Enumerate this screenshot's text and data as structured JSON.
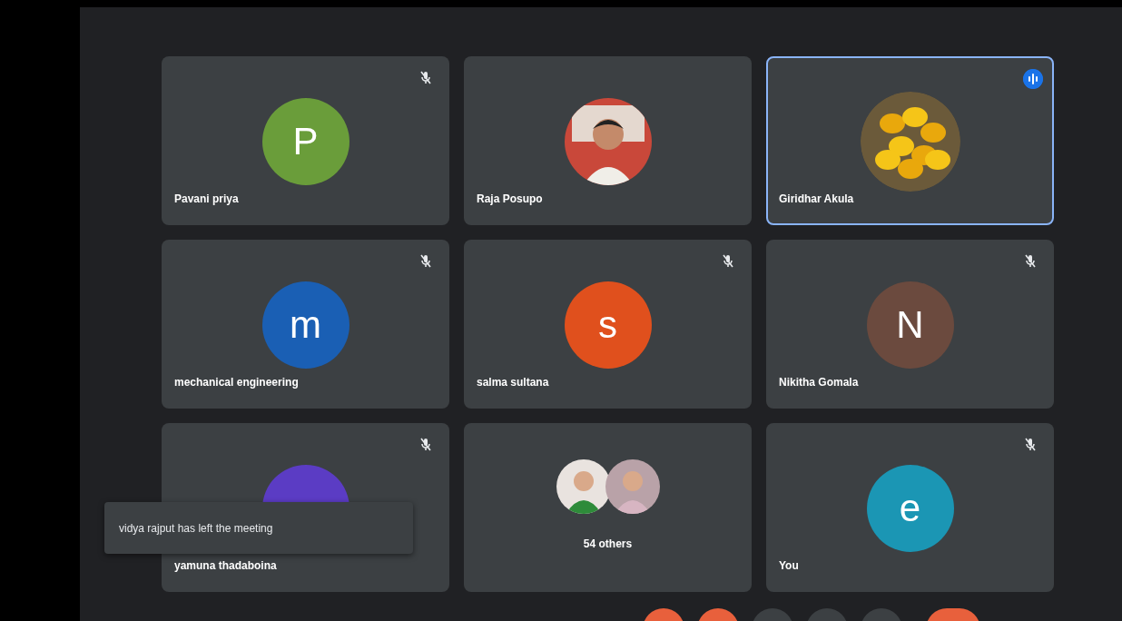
{
  "tiles": [
    {
      "kind": "letter",
      "letter": "P",
      "color": "#6a9d3a",
      "name": "Pavani priya",
      "muted": true,
      "speaking": false
    },
    {
      "name": "Raja Posupo",
      "muted": false,
      "speaking": false
    },
    {
      "name": "Giridhar Akula",
      "muted": false,
      "speaking": true
    },
    {
      "kind": "letter",
      "letter": "m",
      "color": "#1a5fb4",
      "name": "mechanical engineering",
      "muted": true,
      "speaking": false
    },
    {
      "kind": "letter",
      "letter": "s",
      "color": "#e0501d",
      "name": "salma sultana",
      "muted": true,
      "speaking": false
    },
    {
      "kind": "letter",
      "letter": "N",
      "color": "#6b4a3e",
      "name": "Nikitha Gomala",
      "muted": true,
      "speaking": false
    },
    {
      "kind": "letter",
      "color": "#5b3cc4",
      "name": "yamuna thadaboina",
      "muted": true,
      "speaking": false
    },
    {
      "kind": "others",
      "name": "54 others",
      "muted": false,
      "speaking": false
    },
    {
      "kind": "letter",
      "letter": "e",
      "color": "#1b96b4",
      "name": "You",
      "muted": true,
      "speaking": false
    }
  ],
  "toast": {
    "message": "vidya rajput has left the meeting"
  },
  "controls": [
    {
      "color": "#e8603c"
    },
    {
      "color": "#e8603c"
    },
    {
      "color": "#3c4043"
    },
    {
      "color": "#3c4043"
    },
    {
      "color": "#3c4043"
    },
    {
      "color": "#e8603c",
      "kind": "wide"
    }
  ]
}
